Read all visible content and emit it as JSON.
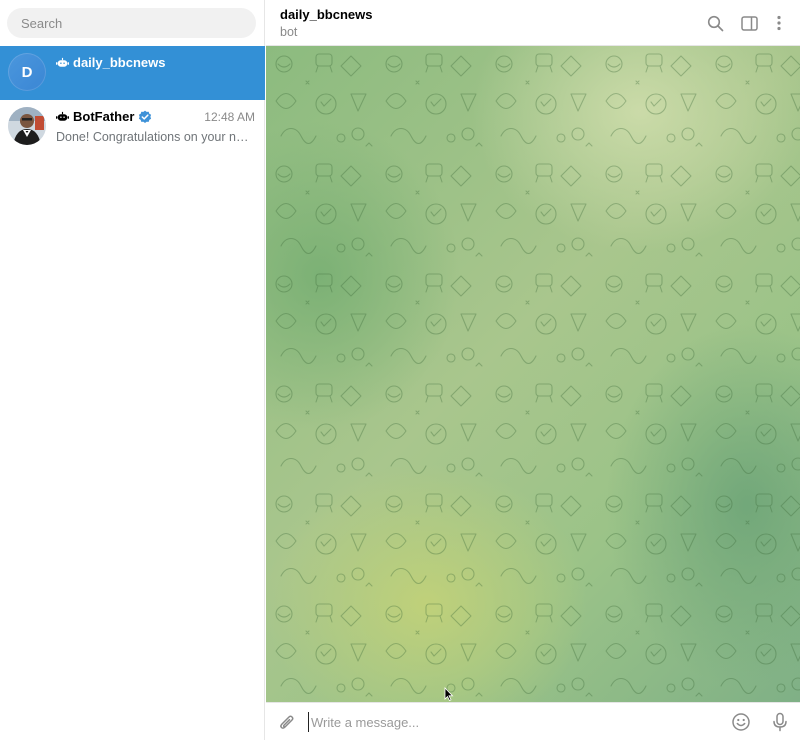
{
  "search": {
    "placeholder": "Search"
  },
  "chats": [
    {
      "name": "daily_bbcnews",
      "avatar_letter": "D",
      "time": "",
      "preview": "",
      "active": true,
      "is_bot": true,
      "verified": false
    },
    {
      "name": "BotFather",
      "avatar_letter": "",
      "time": "12:48 AM",
      "preview": "Done! Congratulations on your new ...",
      "active": false,
      "is_bot": true,
      "verified": true
    }
  ],
  "header": {
    "title": "daily_bbcnews",
    "subtitle": "bot"
  },
  "composer": {
    "placeholder": "Write a message..."
  },
  "colors": {
    "accent": "#3390d6",
    "verified": "#3e92d8",
    "icon": "#8a8a8a"
  },
  "icons": [
    "search-icon",
    "sidebar-toggle-icon",
    "more-vertical-icon",
    "paperclip-icon",
    "emoji-icon",
    "microphone-icon",
    "bot-icon",
    "verified-icon"
  ]
}
